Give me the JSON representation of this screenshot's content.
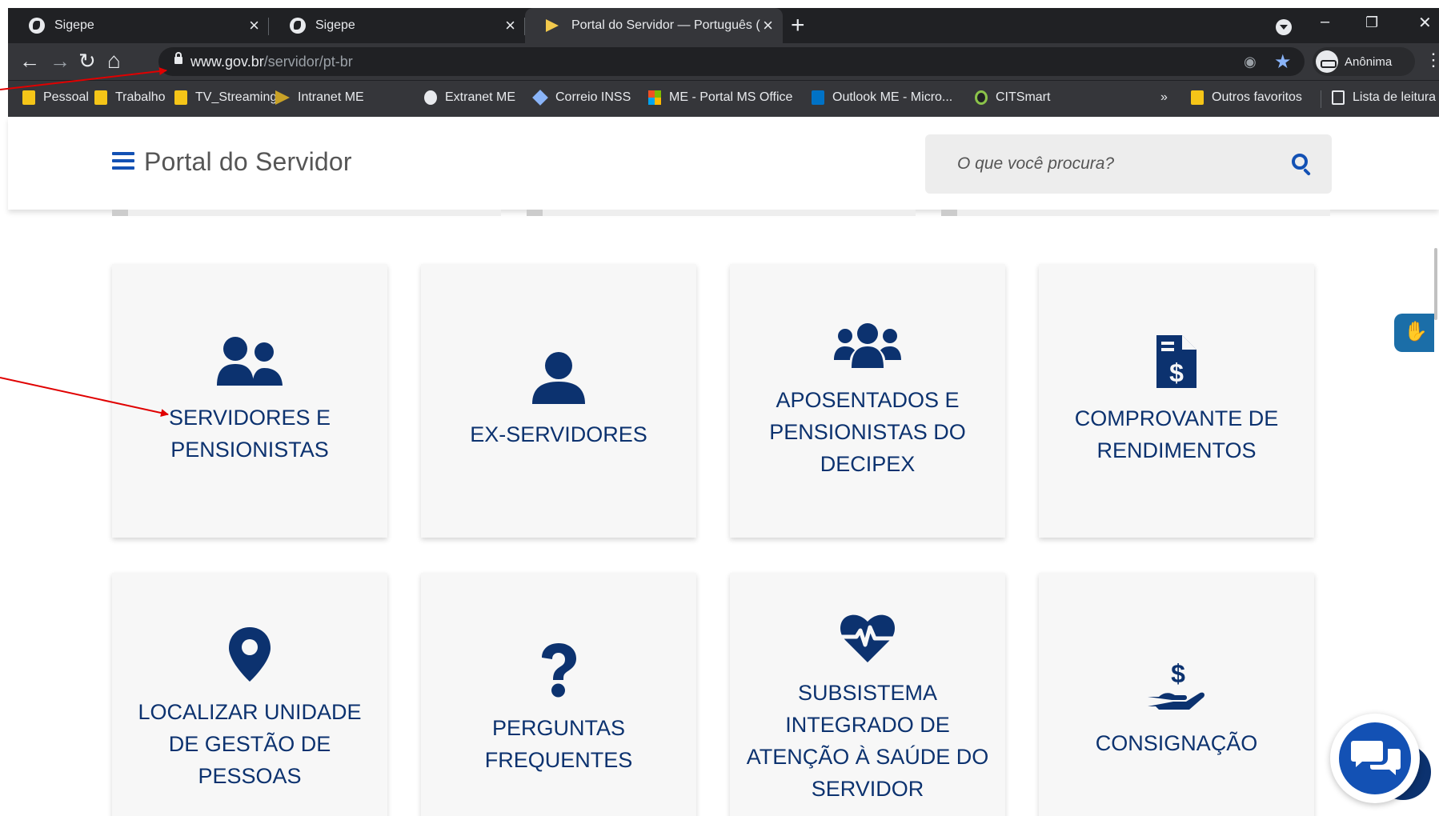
{
  "browser": {
    "tabs": [
      {
        "title": "Sigepe",
        "close": "×"
      },
      {
        "title": "Sigepe",
        "close": "×"
      },
      {
        "title": "Portal do Servidor — Português (",
        "close": "×"
      }
    ],
    "new_tab": "+",
    "window_buttons": {
      "minimize": "–",
      "restore": "❐",
      "close": "✕"
    },
    "nav": {
      "back": "←",
      "forward": "→",
      "reload": "↻",
      "home": "⌂"
    },
    "url": {
      "host": "www.gov.br",
      "path": "/servidor/pt-br"
    },
    "profile_label": "Anônima",
    "menu": "⋮",
    "bookmarks": [
      "Pessoal",
      "Trabalho",
      "TV_Streaming",
      "Intranet ME",
      "Extranet ME",
      "Correio INSS",
      "ME - Portal MS Office",
      "Outlook ME - Micro...",
      "CITSmart"
    ],
    "bookmarks_overflow": "»",
    "other_bookmarks": "Outros favoritos",
    "reading_list": "Lista de leitura"
  },
  "header": {
    "brand": "Portal do Servidor",
    "search_placeholder": "O que você procura?"
  },
  "cards": [
    {
      "label": "SERVIDORES E PENSIONISTAS",
      "icon": "users-icon"
    },
    {
      "label": "EX-SERVIDORES",
      "icon": "user-icon"
    },
    {
      "label": "APOSENTADOS E PENSIONISTAS DO DECIPEX",
      "icon": "group-icon"
    },
    {
      "label": "COMPROVANTE DE RENDIMENTOS",
      "icon": "file-invoice-dollar-icon"
    },
    {
      "label": "LOCALIZAR UNIDADE DE GESTÃO DE PESSOAS",
      "icon": "map-marker-icon"
    },
    {
      "label": "PERGUNTAS FREQUENTES",
      "icon": "question-icon"
    },
    {
      "label": "SUBSISTEMA INTEGRADO DE ATENÇÃO À SAÚDE DO SERVIDOR",
      "icon": "heartbeat-icon"
    },
    {
      "label": "CONSIGNAÇÃO",
      "icon": "hand-holding-dollar-icon"
    }
  ],
  "colors": {
    "brand_blue": "#1351b4",
    "card_text": "#0c326f",
    "card_bg": "#f7f7f7",
    "annotation_red": "#e00000",
    "chrome_dark": "#202124"
  }
}
